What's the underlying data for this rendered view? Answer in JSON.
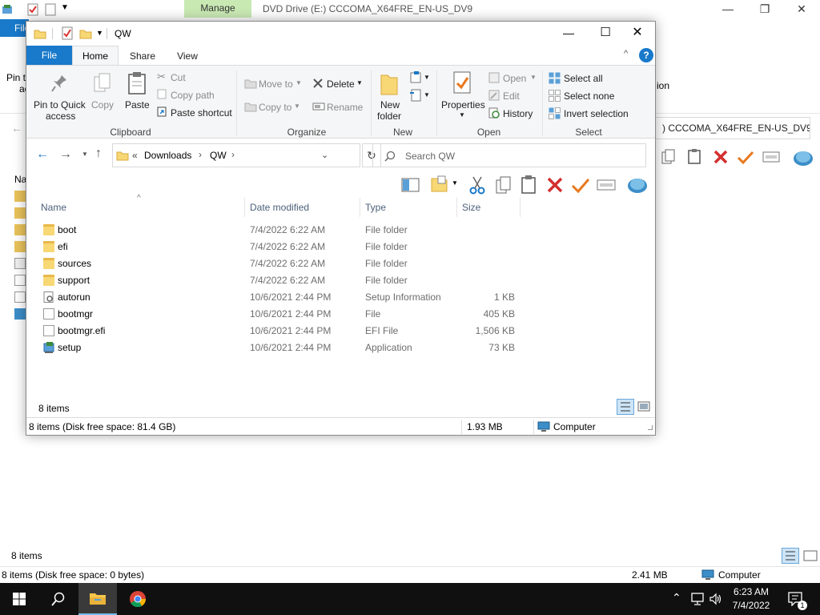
{
  "background_window": {
    "title": "DVD Drive (E:) CCCOMA_X64FRE_EN-US_DV9",
    "context_tab": "Manage",
    "file_tab": "File",
    "address_tail": ") CCCOMA_X64FRE_EN-US_DV9",
    "partial_pin": "Pin t",
    "partial_pin2": "ac",
    "partial_ion": "ion",
    "partial_name_header": "Na",
    "item_count": "8 items",
    "status_left": "8 items (Disk free space: 0 bytes)",
    "status_size": "2.41 MB",
    "status_location": "Computer"
  },
  "window": {
    "title": "QW",
    "tabs": {
      "file": "File",
      "home": "Home",
      "share": "Share",
      "view": "View"
    }
  },
  "ribbon": {
    "clipboard": {
      "label": "Clipboard",
      "pin_line1": "Pin to Quick",
      "pin_line2": "access",
      "copy": "Copy",
      "paste": "Paste",
      "cut": "Cut",
      "copy_path": "Copy path",
      "paste_shortcut": "Paste shortcut"
    },
    "organize": {
      "label": "Organize",
      "move_to": "Move to",
      "copy_to": "Copy to",
      "delete": "Delete",
      "rename": "Rename"
    },
    "new": {
      "label": "New",
      "new_folder_line1": "New",
      "new_folder_line2": "folder"
    },
    "open": {
      "label": "Open",
      "properties": "Properties",
      "open": "Open",
      "edit": "Edit",
      "history": "History"
    },
    "select": {
      "label": "Select",
      "select_all": "Select all",
      "select_none": "Select none",
      "invert_selection": "Invert selection"
    }
  },
  "address": {
    "overflow": "«",
    "crumbs": [
      "Downloads",
      "QW"
    ],
    "search_placeholder": "Search QW"
  },
  "columns": {
    "name": "Name",
    "date": "Date modified",
    "type": "Type",
    "size": "Size"
  },
  "files": [
    {
      "name": "boot",
      "date": "7/4/2022 6:22 AM",
      "type": "File folder",
      "size": "",
      "icon": "folder-icon"
    },
    {
      "name": "efi",
      "date": "7/4/2022 6:22 AM",
      "type": "File folder",
      "size": "",
      "icon": "folder-icon"
    },
    {
      "name": "sources",
      "date": "7/4/2022 6:22 AM",
      "type": "File folder",
      "size": "",
      "icon": "folder-icon"
    },
    {
      "name": "support",
      "date": "7/4/2022 6:22 AM",
      "type": "File folder",
      "size": "",
      "icon": "folder-icon"
    },
    {
      "name": "autorun",
      "date": "10/6/2021 2:44 PM",
      "type": "Setup Information",
      "size": "1 KB",
      "icon": "settings-file-icon"
    },
    {
      "name": "bootmgr",
      "date": "10/6/2021 2:44 PM",
      "type": "File",
      "size": "405 KB",
      "icon": "file-icon"
    },
    {
      "name": "bootmgr.efi",
      "date": "10/6/2021 2:44 PM",
      "type": "EFI File",
      "size": "1,506 KB",
      "icon": "file-icon"
    },
    {
      "name": "setup",
      "date": "10/6/2021 2:44 PM",
      "type": "Application",
      "size": "73 KB",
      "icon": "setup-app-icon"
    }
  ],
  "status": {
    "count": "8 items",
    "left": "8 items (Disk free space: 81.4 GB)",
    "size": "1.93 MB",
    "location": "Computer"
  },
  "taskbar": {
    "time": "6:23 AM",
    "date": "7/4/2022",
    "notification_count": "1"
  },
  "colors": {
    "file_tab": "#1979ca",
    "manage_tab": "#c9e9b3",
    "folder": "#f8d775",
    "delete_red": "#d32f2f",
    "check_orange": "#e8781e",
    "taskbar": "#101010"
  }
}
